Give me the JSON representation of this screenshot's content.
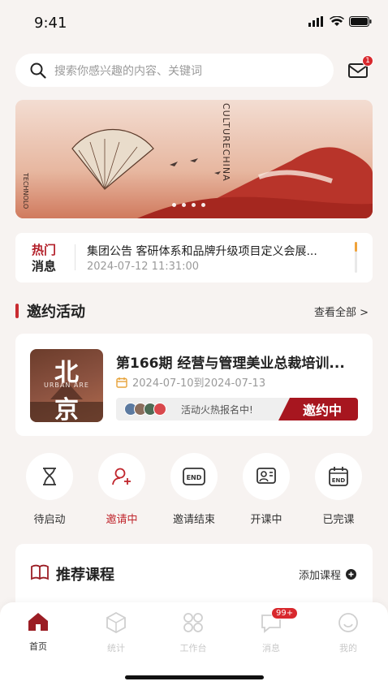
{
  "status_bar": {
    "time": "9:41"
  },
  "search": {
    "placeholder": "搜索你感兴趣的内容、关键词",
    "mail_badge": "1"
  },
  "banner": {
    "slides": 4,
    "active_slide": 0,
    "text_culture": "CULTURECHINA",
    "text_side": "TECHNOLO"
  },
  "news": {
    "tag_line1": "热门",
    "tag_line2": "消息",
    "title": "集团公告 客研体系和品牌升级项目定义会展...",
    "date": "2024-07-12 11:31:00"
  },
  "invite_section": {
    "title": "邀约活动",
    "more": "查看全部 >"
  },
  "activity": {
    "thumb_big1": "北",
    "thumb_small": "URBAN ARE",
    "thumb_big2": "京",
    "title": "第166期 经营与管理美业总裁培训...",
    "date": "2024-07-10到2024-07-13",
    "hint": "活动火热报名中!",
    "status": "邀约中"
  },
  "quick_status": [
    {
      "label": "待启动",
      "icon": "hourglass-icon",
      "active": false
    },
    {
      "label": "邀请中",
      "icon": "add-user-icon",
      "active": true
    },
    {
      "label": "邀请结束",
      "icon": "end-icon",
      "active": false
    },
    {
      "label": "开课中",
      "icon": "class-icon",
      "active": false
    },
    {
      "label": "已完课",
      "icon": "calendar-end-icon",
      "active": false
    }
  ],
  "recommend": {
    "title": "推荐课程",
    "add": "添加课程"
  },
  "tabbar": {
    "items": [
      {
        "label": "首页",
        "active": true
      },
      {
        "label": "统计",
        "active": false
      },
      {
        "label": "工作台",
        "active": false
      },
      {
        "label": "消息",
        "active": false,
        "badge": "99+"
      },
      {
        "label": "我的",
        "active": false
      }
    ]
  },
  "colors": {
    "accent": "#c0262d",
    "background": "#f7f3f1"
  }
}
